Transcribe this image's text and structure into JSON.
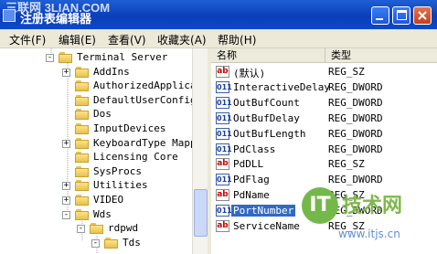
{
  "window": {
    "title": "注册表编辑器",
    "watermark_top": "三联网 3LIAN.COM"
  },
  "menu": [
    {
      "label": "文件",
      "key": "(F)"
    },
    {
      "label": "编辑",
      "key": "(E)"
    },
    {
      "label": "查看",
      "key": "(V)"
    },
    {
      "label": "收藏夹",
      "key": "(A)"
    },
    {
      "label": "帮助",
      "key": "(H)"
    }
  ],
  "tree": [
    {
      "label": "Terminal Server",
      "expander": "-",
      "level": 0
    },
    {
      "label": "AddIns",
      "expander": "+",
      "level": 1
    },
    {
      "label": "AuthorizedApplica",
      "expander": "",
      "level": 1
    },
    {
      "label": "DefaultUserConfig",
      "expander": "",
      "level": 1
    },
    {
      "label": "Dos",
      "expander": "",
      "level": 1
    },
    {
      "label": "InputDevices",
      "expander": "",
      "level": 1
    },
    {
      "label": "KeyboardType Mapp:",
      "expander": "+",
      "level": 1
    },
    {
      "label": "Licensing Core",
      "expander": "",
      "level": 1
    },
    {
      "label": "SysProcs",
      "expander": "",
      "level": 1
    },
    {
      "label": "Utilities",
      "expander": "+",
      "level": 1
    },
    {
      "label": "VIDEO",
      "expander": "+",
      "level": 1
    },
    {
      "label": "Wds",
      "expander": "-",
      "level": 1
    },
    {
      "label": "rdpwd",
      "expander": "-",
      "level": 2
    },
    {
      "label": "Tds",
      "expander": "-",
      "level": 3
    }
  ],
  "list": {
    "headers": {
      "name": "名称",
      "type": "类型"
    },
    "rows": [
      {
        "icon": "string",
        "name": "(默认)",
        "type": "REG_SZ"
      },
      {
        "icon": "dword",
        "name": "InteractiveDelay",
        "type": "REG_DWORD"
      },
      {
        "icon": "dword",
        "name": "OutBufCount",
        "type": "REG_DWORD"
      },
      {
        "icon": "dword",
        "name": "OutBufDelay",
        "type": "REG_DWORD"
      },
      {
        "icon": "dword",
        "name": "OutBufLength",
        "type": "REG_DWORD"
      },
      {
        "icon": "dword",
        "name": "PdClass",
        "type": "REG_DWORD"
      },
      {
        "icon": "string",
        "name": "PdDLL",
        "type": "REG_SZ"
      },
      {
        "icon": "dword",
        "name": "PdFlag",
        "type": "REG_DWORD"
      },
      {
        "icon": "string",
        "name": "PdName",
        "type": "REG_SZ"
      },
      {
        "icon": "dword",
        "name": "PortNumber",
        "type": "REG_DWORD",
        "selected": true
      },
      {
        "icon": "string",
        "name": "ServiceName",
        "type": "REG_SZ"
      }
    ]
  },
  "site_watermark": {
    "glyph": "IT",
    "main": "技术网",
    "url": "www.itjs.cn"
  },
  "icon_glyphs": {
    "string": "ab",
    "dword": "011"
  },
  "colors": {
    "titlebar": "#0a3fb8",
    "selection": "#316ac5",
    "menubar": "#ece9d8"
  }
}
